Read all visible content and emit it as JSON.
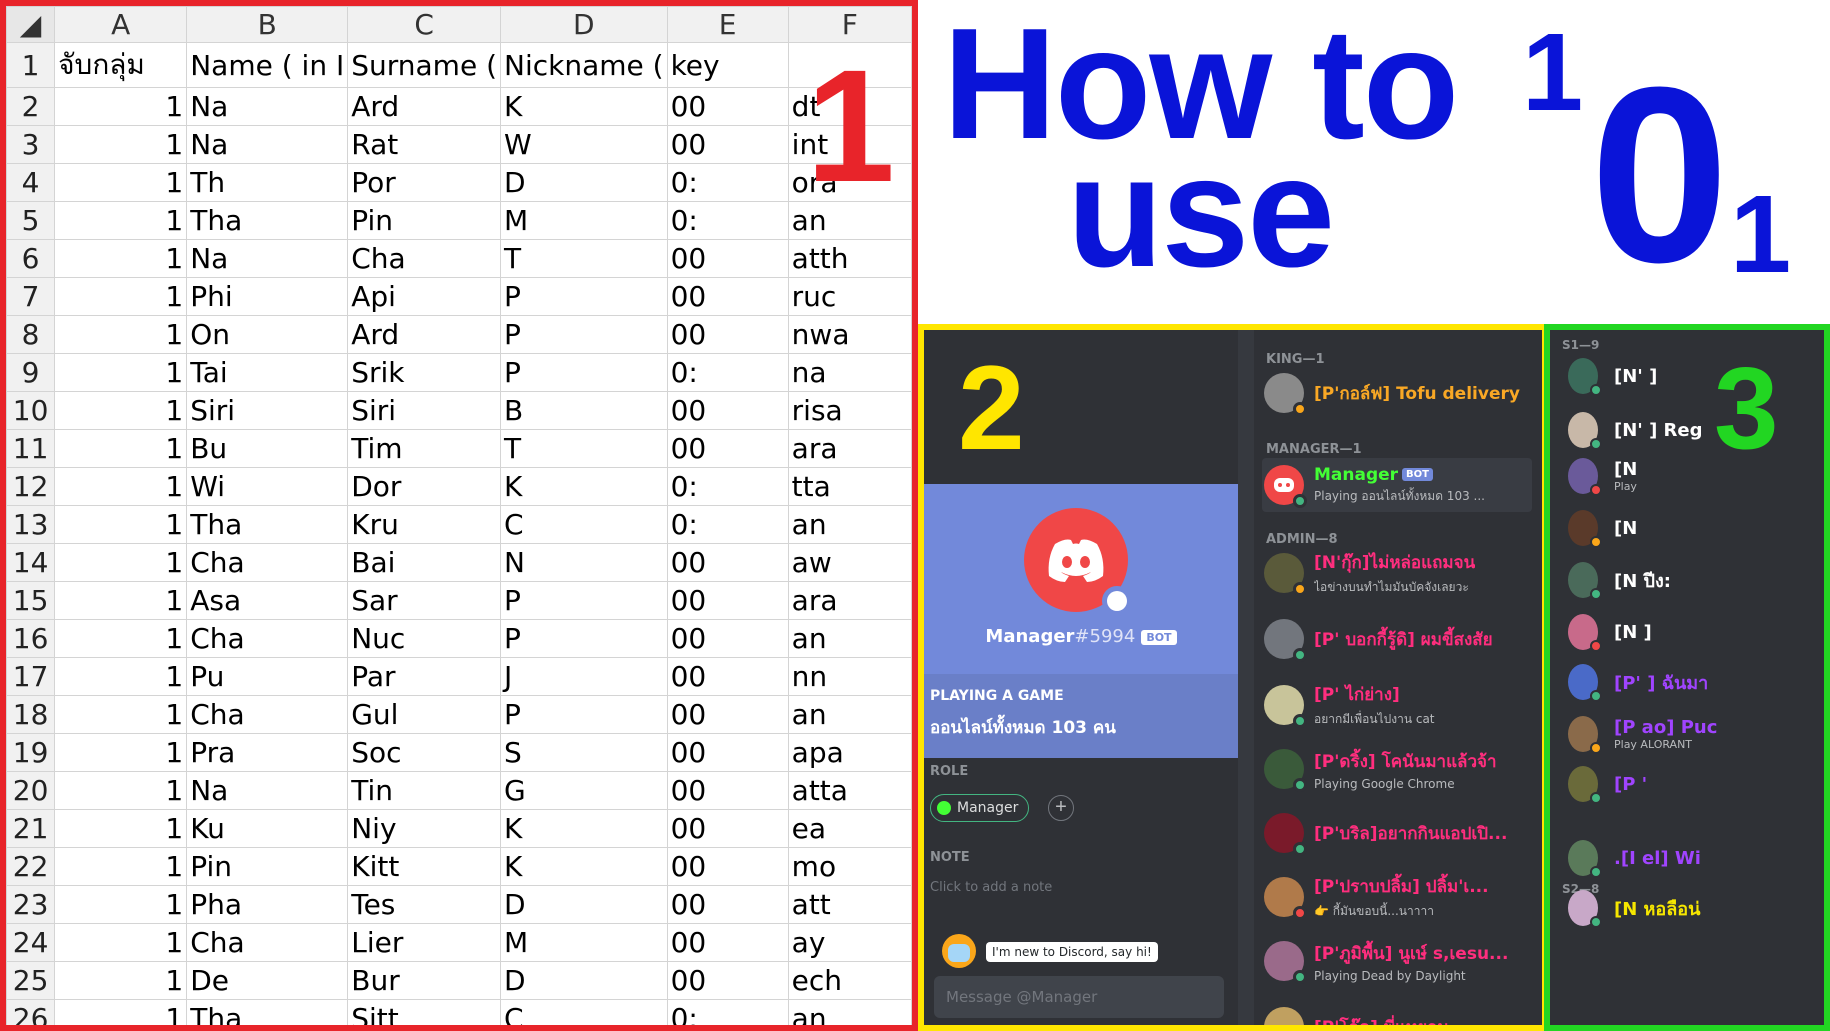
{
  "sheet": {
    "columns": [
      "A",
      "B",
      "C",
      "D",
      "E",
      "F"
    ],
    "header_row": {
      "num": "1",
      "a": "จับกลุ่ม",
      "b": "Name ( in I",
      "c": "Surname (",
      "d": "Nickname (",
      "e": "key",
      "f": ""
    },
    "rows": [
      {
        "num": "2",
        "a": "1",
        "b": "Na",
        "c": "Ard",
        "d": "K",
        "e": "00",
        "f": "dt"
      },
      {
        "num": "3",
        "a": "1",
        "b": "Na",
        "c": "Rat",
        "d": "W",
        "e": "00",
        "f": "int"
      },
      {
        "num": "4",
        "a": "1",
        "b": "Th",
        "c": "Por",
        "d": "D",
        "e": "0:",
        "f": "ora"
      },
      {
        "num": "5",
        "a": "1",
        "b": "Tha",
        "c": "Pin",
        "d": "M",
        "e": "0:",
        "f": "an"
      },
      {
        "num": "6",
        "a": "1",
        "b": "Na",
        "c": "Cha",
        "d": "T",
        "e": "00",
        "f": "atth"
      },
      {
        "num": "7",
        "a": "1",
        "b": "Phi",
        "c": "Api",
        "d": "P",
        "e": "00",
        "f": "ruc"
      },
      {
        "num": "8",
        "a": "1",
        "b": "On",
        "c": "Ard",
        "d": "P",
        "e": "00",
        "f": "nwa"
      },
      {
        "num": "9",
        "a": "1",
        "b": "Tai",
        "c": "Srik",
        "d": "P",
        "e": "0:",
        "f": "na"
      },
      {
        "num": "10",
        "a": "1",
        "b": "Siri",
        "c": "Siri",
        "d": "B",
        "e": "00",
        "f": "risa"
      },
      {
        "num": "11",
        "a": "1",
        "b": "Bu",
        "c": "Tim",
        "d": "T",
        "e": "00",
        "f": "ara"
      },
      {
        "num": "12",
        "a": "1",
        "b": "Wi",
        "c": "Dor",
        "d": "K",
        "e": "0:",
        "f": "tta"
      },
      {
        "num": "13",
        "a": "1",
        "b": "Tha",
        "c": "Kru",
        "d": "C",
        "e": "0:",
        "f": "an"
      },
      {
        "num": "14",
        "a": "1",
        "b": "Cha",
        "c": "Bai",
        "d": "N",
        "e": "00",
        "f": "aw"
      },
      {
        "num": "15",
        "a": "1",
        "b": "Asa",
        "c": "Sar",
        "d": "P",
        "e": "00",
        "f": "ara"
      },
      {
        "num": "16",
        "a": "1",
        "b": "Cha",
        "c": "Nuc",
        "d": "P",
        "e": "00",
        "f": "an"
      },
      {
        "num": "17",
        "a": "1",
        "b": "Pu",
        "c": "Par",
        "d": "J",
        "e": "00",
        "f": "nn"
      },
      {
        "num": "18",
        "a": "1",
        "b": "Cha",
        "c": "Gul",
        "d": "P",
        "e": "00",
        "f": "an"
      },
      {
        "num": "19",
        "a": "1",
        "b": "Pra",
        "c": "Soc",
        "d": "S",
        "e": "00",
        "f": "apa"
      },
      {
        "num": "20",
        "a": "1",
        "b": "Na",
        "c": "Tin",
        "d": "G",
        "e": "00",
        "f": "atta"
      },
      {
        "num": "21",
        "a": "1",
        "b": "Ku",
        "c": "Niy",
        "d": "K",
        "e": "00",
        "f": "ea"
      },
      {
        "num": "22",
        "a": "1",
        "b": "Pin",
        "c": "Kitt",
        "d": "K",
        "e": "00",
        "f": "mo"
      },
      {
        "num": "23",
        "a": "1",
        "b": "Pha",
        "c": "Tes",
        "d": "D",
        "e": "00",
        "f": "att"
      },
      {
        "num": "24",
        "a": "1",
        "b": "Cha",
        "c": "Lier",
        "d": "M",
        "e": "00",
        "f": "ay"
      },
      {
        "num": "25",
        "a": "1",
        "b": "De",
        "c": "Bur",
        "d": "D",
        "e": "00",
        "f": "ech"
      },
      {
        "num": "26",
        "a": "1",
        "b": "Tha",
        "c": "Sitt",
        "d": "C",
        "e": "0:",
        "f": "an"
      }
    ],
    "big_number": "1"
  },
  "title": {
    "line1": "How to",
    "line2": "use",
    "logo": {
      "top": "1",
      "mid": "0",
      "bottom": "1"
    }
  },
  "panel2": {
    "big_number": "2",
    "profile": {
      "name": "Manager",
      "discriminator": "#5994",
      "bot_tag": "BOT",
      "playing_heading": "PLAYING A GAME",
      "playing_value": "ออนไลน์ทั้งหมด 103 คน",
      "role_heading": "ROLE",
      "role_name": "Manager",
      "role_add": "+",
      "note_heading": "NOTE",
      "note_placeholder": "Click to add a note",
      "new_bubble": "I'm new to Discord, say hi!",
      "message_placeholder": "Message @Manager"
    },
    "groups": {
      "king": "KING—1",
      "manager": "MANAGER—1",
      "admin": "ADMIN—8"
    },
    "members": [
      {
        "name": "[P'กอล์ฟ] Tofu delivery",
        "sub": "",
        "color": "#f9a825",
        "tag": ""
      },
      {
        "name": "Manager",
        "sub": "Playing ออนไลน์ทั้งหมด 103 ...",
        "color": "#43ff35",
        "tag": "BOT"
      },
      {
        "name": "[N'กุ๊ก]ไม่หล่อแถมจน",
        "sub": "ไอข่างบนทำไมมันบัคจังเลยวะ",
        "color": "#ff2e7e",
        "tag": ""
      },
      {
        "name": "[P' บอกกี้รู้ดิ] ผมขี้สงสัย",
        "sub": "",
        "color": "#ff2e7e",
        "tag": ""
      },
      {
        "name": "[P' ไก่ย่าง]",
        "sub": "อยากมีเพื่อนไปงาน cat",
        "color": "#ff2e7e",
        "tag": ""
      },
      {
        "name": "[P'ดริ้ง] โคนันมาแล้วจ้า",
        "sub": "Playing Google Chrome",
        "color": "#ff2e7e",
        "tag": ""
      },
      {
        "name": "[P'บริล]อยากกินแอปเปิ...",
        "sub": "",
        "color": "#ff2e7e",
        "tag": ""
      },
      {
        "name": "[P'ปราบปลิ้ม] ปลิ้ม'เ...",
        "sub": "👉 กี้มันขอบนี้...นาาาา",
        "color": "#ff2e7e",
        "tag": ""
      },
      {
        "name": "[P'ภูมิพื้น] นูเษ์ s,เesu...",
        "sub": "Playing Dead by Daylight",
        "color": "#ff2e7e",
        "tag": ""
      },
      {
        "name": "[P'โอ๊ค] พี่แทยอน",
        "sub": "",
        "color": "#ff2e7e",
        "tag": ""
      }
    ]
  },
  "panel3": {
    "big_number": "3",
    "group1": "S1—9",
    "group2": "S2—8",
    "rows": [
      {
        "name": "[N'        ]",
        "sub": "",
        "color": "#ffffff"
      },
      {
        "name": "[N'        ] Reg",
        "sub": "",
        "color": "#ffffff"
      },
      {
        "name": "[N",
        "sub": "Play",
        "color": "#ffffff"
      },
      {
        "name": "[N",
        "sub": "",
        "color": "#ffffff"
      },
      {
        "name": "[N              ปีง:",
        "sub": "",
        "color": "#ffffff"
      },
      {
        "name": "[N              ]",
        "sub": "",
        "color": "#ffffff"
      },
      {
        "name": "[P'             ] ฉันมา",
        "sub": "",
        "color": "#a044ff"
      },
      {
        "name": "[P              ao] Puc",
        "sub": "Play            ALORANT",
        "color": "#a044ff"
      },
      {
        "name": "[P              '",
        "sub": "",
        "color": "#a044ff"
      },
      {
        "name": ".[I              el] Wi",
        "sub": "",
        "color": "#a044ff"
      },
      {
        "name": "[N              หอลือน่",
        "sub": "",
        "color": "#f6e600"
      }
    ]
  },
  "colors": {
    "red_frame": "#e8242a",
    "yellow_frame": "#ffe600",
    "green_frame": "#22d622",
    "title_blue": "#0a14d8",
    "discord_dark": "#36393f",
    "discord_blurple": "#7289da"
  }
}
